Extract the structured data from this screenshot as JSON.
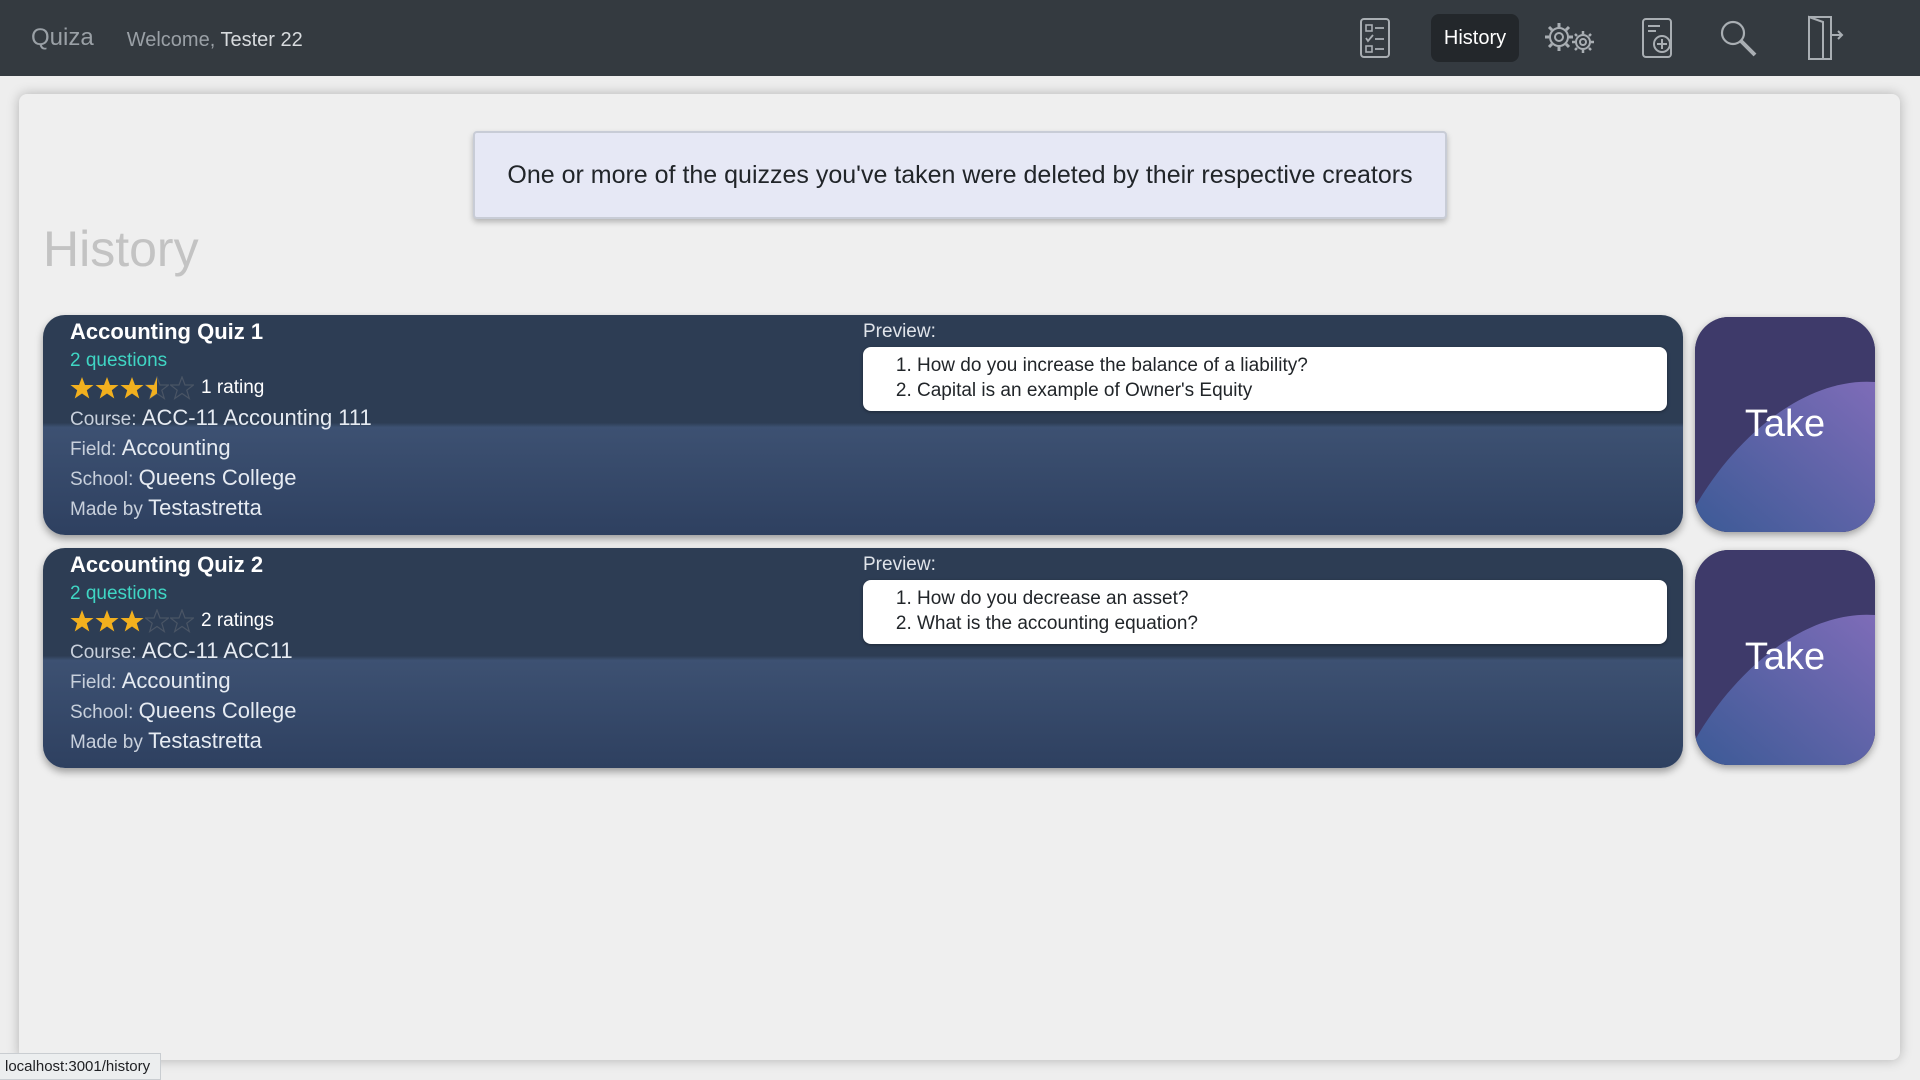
{
  "nav": {
    "brand": "Quiza",
    "welcome_prefix": "Welcome,",
    "username": "Tester 22",
    "history_label": "History",
    "icons": [
      "quizzes-checklist-icon",
      "settings-gears-icon",
      "create-quiz-icon",
      "search-icon",
      "logout-icon"
    ]
  },
  "alert": {
    "message": "One or more of the quizzes you've taken were deleted by their respective creators"
  },
  "page": {
    "title": "History"
  },
  "quizzes": [
    {
      "title": "Accounting Quiz 1",
      "questions": "2 questions",
      "stars": 3.5,
      "rating_text": "1 rating",
      "course_label": "Course:",
      "course": "ACC-11 Accounting 111",
      "field_label": "Field:",
      "field": "Accounting",
      "school_label": "School:",
      "school": "Queens College",
      "made_label": "Made by",
      "author": "Testastretta",
      "preview_label": "Preview:",
      "preview": [
        "How do you increase the balance of a liability?",
        "Capital is an example of Owner's Equity"
      ],
      "take_label": "Take"
    },
    {
      "title": "Accounting Quiz 2",
      "questions": "2 questions",
      "stars": 3,
      "rating_text": "2 ratings",
      "course_label": "Course:",
      "course": "ACC-11 ACC11",
      "field_label": "Field:",
      "field": "Accounting",
      "school_label": "School:",
      "school": "Queens College",
      "made_label": "Made by",
      "author": "Testastretta",
      "preview_label": "Preview:",
      "preview": [
        "How do you decrease an asset?",
        "What is the accounting equation?"
      ],
      "take_label": "Take"
    }
  ],
  "status": {
    "url": "localhost:3001/history"
  },
  "colors": {
    "navbar": "#343a40",
    "card_dark": "#2d3d54",
    "card_light": "#3d5172",
    "questions_teal": "#3fd6c4",
    "star_gold": "#f2b01e",
    "take_purple": "#3e3a6a"
  }
}
